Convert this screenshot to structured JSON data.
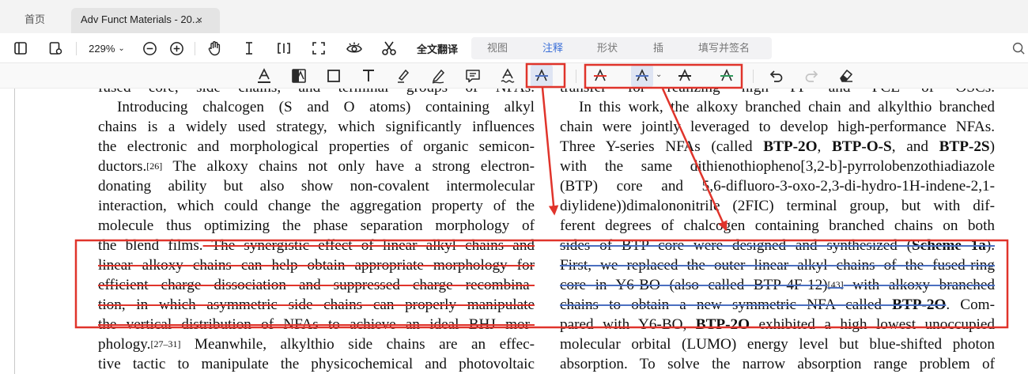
{
  "tabs": {
    "home": "首页",
    "doc_title": "Adv Funct Materials - 20...",
    "close_glyph": "×"
  },
  "toolbar": {
    "zoom": "229%",
    "translate": "全文翻译",
    "tool_tabs": [
      "视图",
      "注释",
      "形状",
      "插",
      "填写并签名"
    ],
    "active_tab": "注释"
  },
  "annotation_toolbar": {
    "text_color": "#2b2b2b",
    "selected_tool": "strike-blue",
    "strike_tools": [
      {
        "name": "strike-red",
        "color": "#e0342b"
      },
      {
        "name": "strike-blue",
        "color": "#4b6fc0"
      },
      {
        "name": "strike-black",
        "color": "#222222"
      },
      {
        "name": "strike-green",
        "color": "#2f9a5c"
      }
    ]
  },
  "callouts": {
    "color": "#e0342b"
  },
  "document": {
    "left_column": [
      {
        "t": "fused core, side chains, and terminal groups of NFAs."
      },
      {
        "t": "Introducing chalcogen (S and O atoms) containing alkyl"
      },
      {
        "t": "chains is a widely used strategy, which significantly influences"
      },
      {
        "t": "the electronic and morphological properties of organic semicon-"
      },
      {
        "t": "ductors.",
        "sup": "[26]",
        "t2": " The alkoxy chains not only have a strong electron-"
      },
      {
        "t": "donating ability but also show non-covalent intermolecular"
      },
      {
        "t": "interaction, which could change the aggregation property of the"
      },
      {
        "t": "molecule thus optimizing the phase separation morphology of"
      },
      {
        "t": "the blend films.",
        "s": " The synergistic effect of linear alkyl chains and"
      },
      {
        "s": "linear alkoxy chains can help obtain appropriate morphology for"
      },
      {
        "s": "efficient charge dissociation and suppressed charge recombina-"
      },
      {
        "s": "tion, in which asymmetric side chains can properly manipulate"
      },
      {
        "s": "the vertical distribution of NFAs to achieve an ideal BHJ mor-"
      },
      {
        "t": "phology.",
        "sup": "[27–31]",
        "t2": " Meanwhile, alkylthio side chains are an effec-"
      },
      {
        "t": "tive tactic to manipulate the physicochemical and photovoltaic"
      }
    ],
    "right_column": {
      "l00": "transfer for realizing high FF and PCE of OSCs.",
      "l01": "In this work, the alkoxy branched chain and alkylthio branched",
      "l02": "chain were jointly leveraged to develop high-performance NFAs.",
      "l03_a": "Three Y-series NFAs (called ",
      "l03_b": "BTP-2O",
      "l03_c": ", ",
      "l03_d": "BTP-O-S",
      "l03_e": ", and ",
      "l03_f": "BTP-2S",
      "l03_g": ")",
      "l04": "with the same dithienothiopheno[3,2-b]-pyrrolobenzothiadiazole",
      "l05": "(BTP) core and 5,6-difluoro-3-oxo-2,3-di-hydro-1H-indene-2,1-",
      "l06": "diylidene))dimalononitrile (2FIC) terminal group, but with dif-",
      "l07": "ferent degrees of chalcogen containing branched chains on both",
      "l08_a": "sides of BTP core were designed and synthesized (",
      "l08_b": "Scheme 1a",
      "l08_c": ").",
      "l09": "First, we replaced the outer linear alkyl chains of the fused-ring",
      "l10_a": "core in Y6-BO (also called BTP-4F-12)",
      "l10_sup": "[43]",
      "l10_b": " with alkoxy branched",
      "l11_a": "chains to obtain a new symmetric NFA called ",
      "l11_b": "BTP-2O",
      "l11_c": ". Com-",
      "l12_a": "pared with Y6-BO, ",
      "l12_b": "BTP-2O",
      "l12_c": " exhibited a high lowest unoccupied",
      "l13": "molecular orbital (LUMO) energy level but blue-shifted photon",
      "l14": "absorption. To solve the narrow absorption range problem of"
    }
  }
}
